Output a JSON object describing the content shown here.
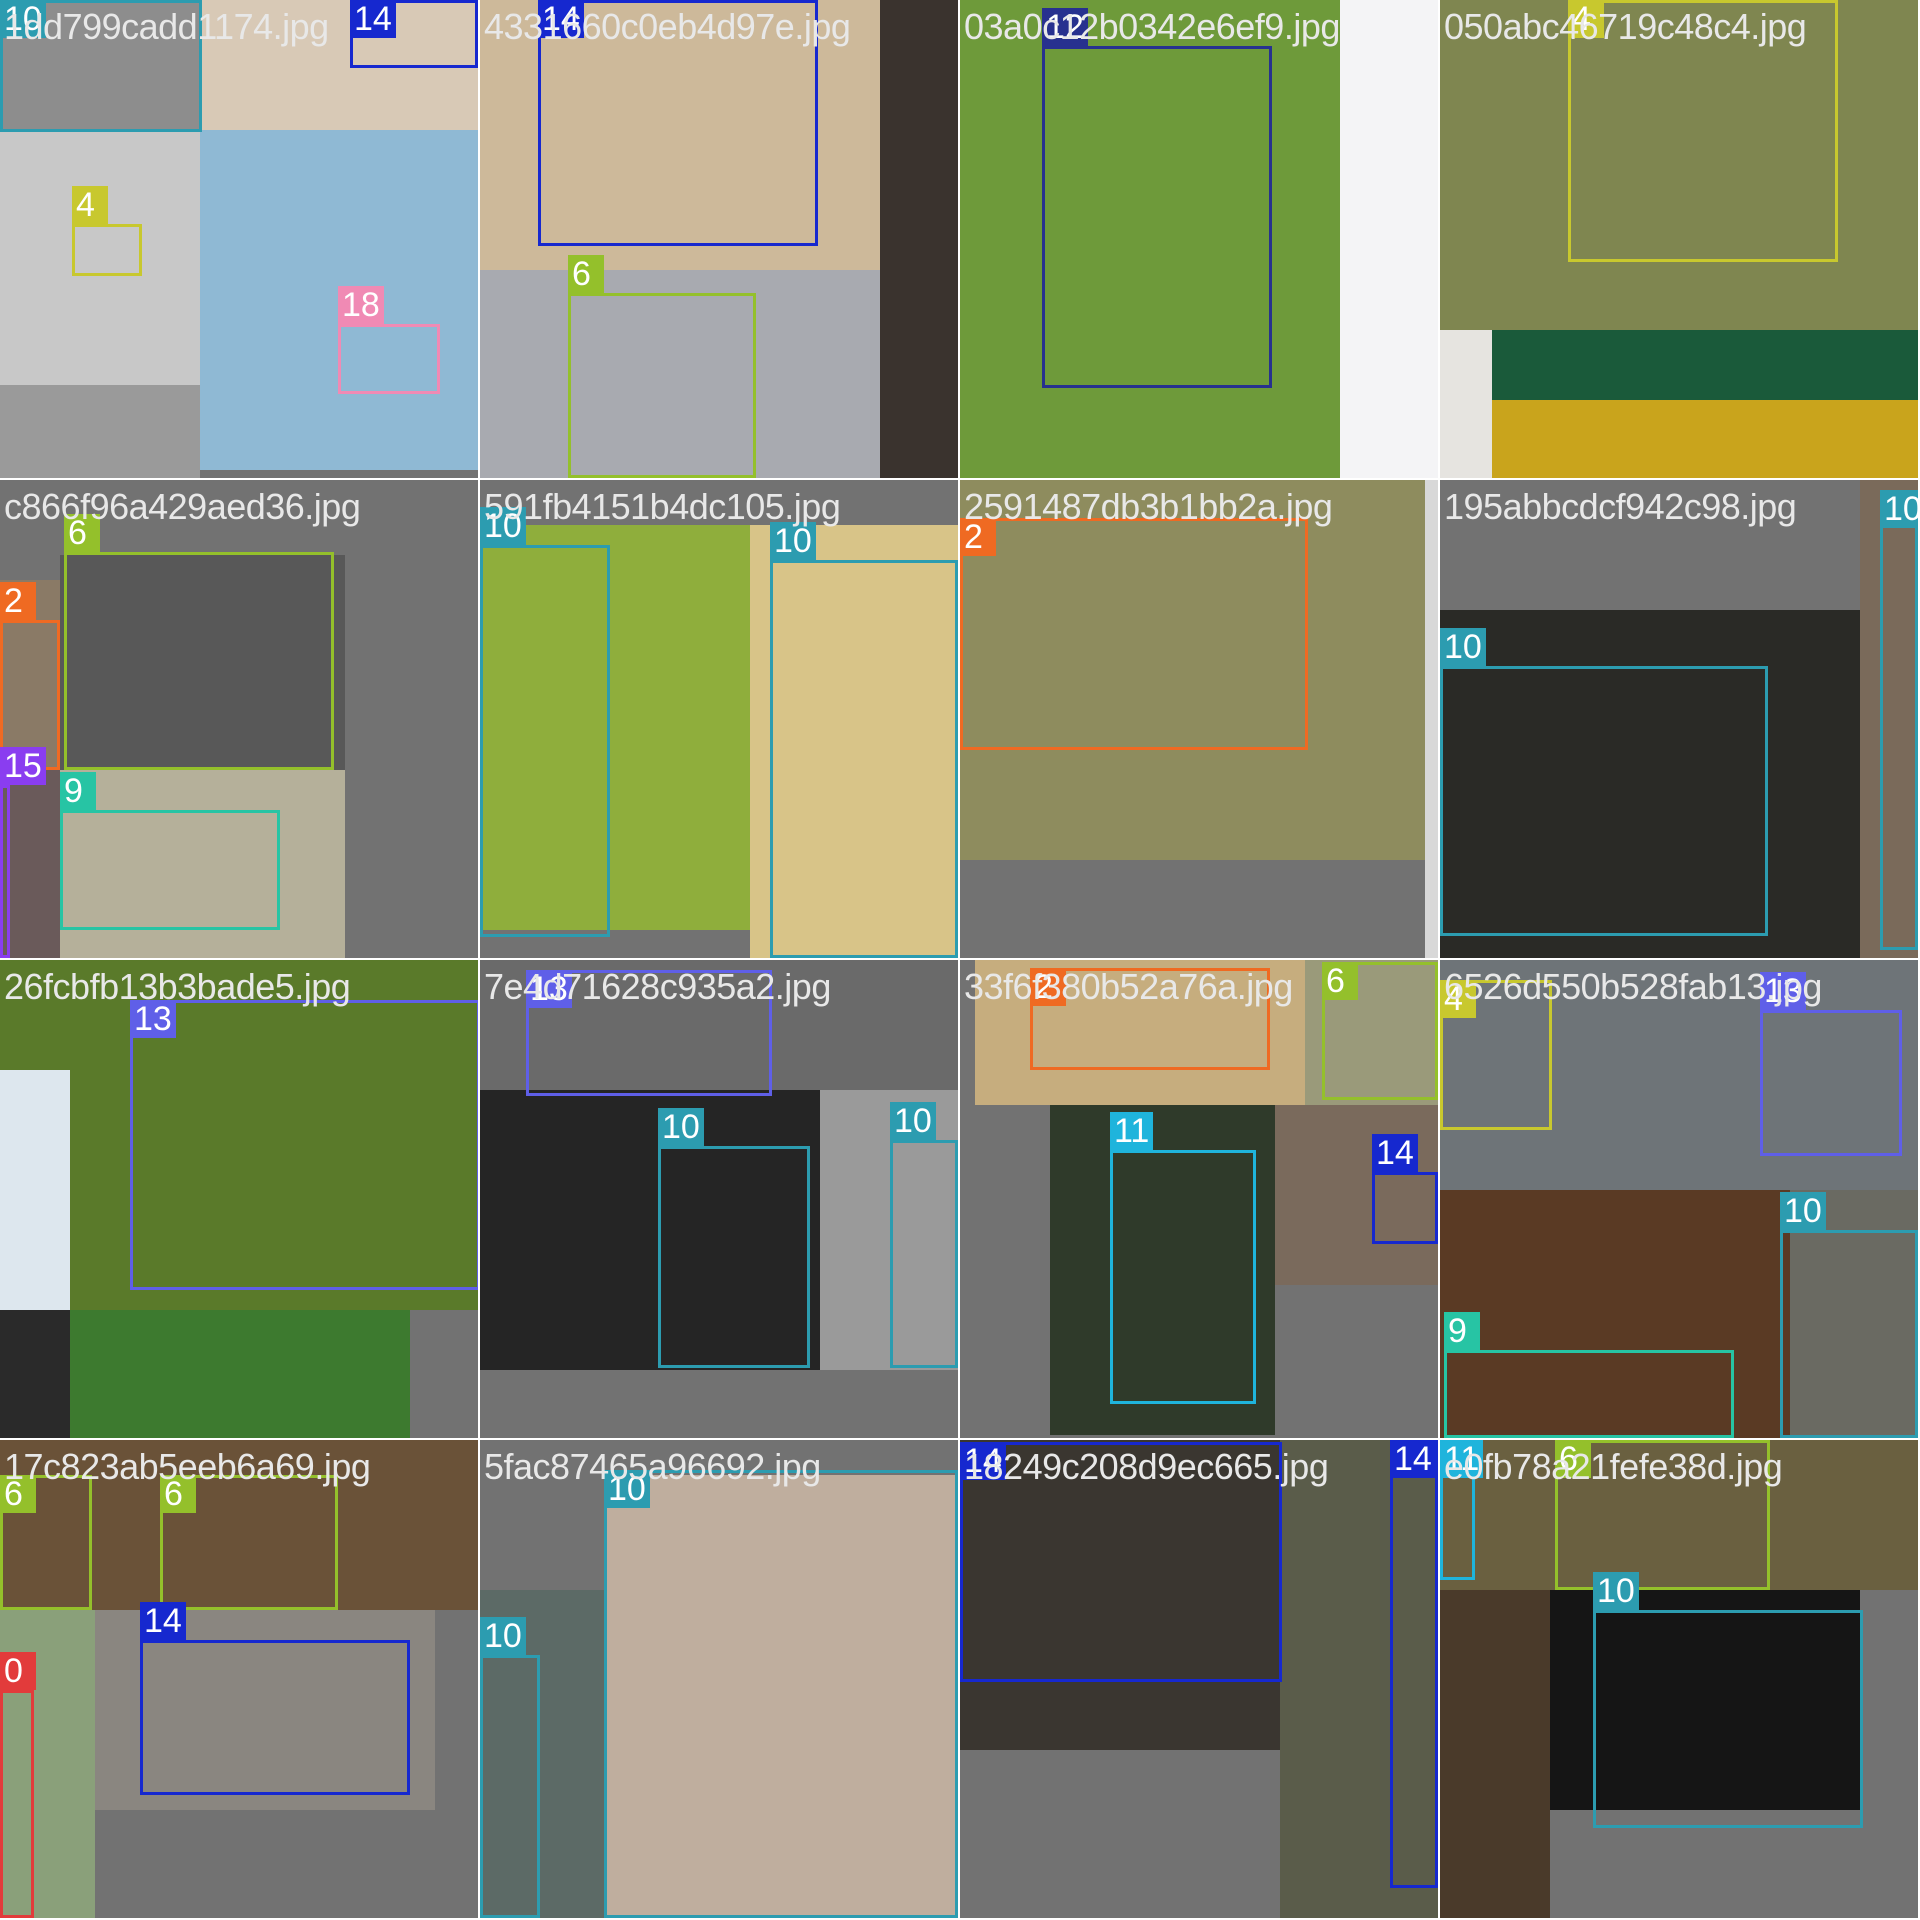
{
  "class_colors": {
    "0": "#e23b3b",
    "2": "#ef6a22",
    "4": "#c8c82e",
    "6": "#94c02b",
    "9": "#27c4a4",
    "10": "#2c9cb0",
    "11": "#1fb4dc",
    "12": "#27318f",
    "13": "#5f5fe8",
    "14": "#1628cf",
    "15": "#8a3df0",
    "18": "#f08ab4"
  },
  "tiles": [
    {
      "filename": "1dd799cadd1174.jpg",
      "boxes": [
        {
          "cls": "10"
        },
        {
          "cls": "14"
        },
        {
          "cls": "4"
        },
        {
          "cls": "18"
        }
      ]
    },
    {
      "filename": "4331660c0eb4d97e.jpg",
      "boxes": [
        {
          "cls": "14"
        },
        {
          "cls": "6"
        }
      ]
    },
    {
      "filename": "03a0c12b0342e6ef9.jpg",
      "boxes": [
        {
          "cls": "12"
        }
      ]
    },
    {
      "filename": "050abc46719c48c4.jpg",
      "boxes": [
        {
          "cls": "4"
        }
      ]
    },
    {
      "filename": "c866f96a429aed36.jpg",
      "boxes": [
        {
          "cls": "6"
        },
        {
          "cls": "2"
        },
        {
          "cls": "15"
        },
        {
          "cls": "9"
        }
      ]
    },
    {
      "filename": "591fb4151b4dc105.jpg",
      "boxes": [
        {
          "cls": "10"
        },
        {
          "cls": "10"
        }
      ]
    },
    {
      "filename": "2591487db3b1bb2a.jpg",
      "boxes": [
        {
          "cls": "2"
        }
      ]
    },
    {
      "filename": "195abbcdcf942c98.jpg",
      "boxes": [
        {
          "cls": "10"
        },
        {
          "cls": "10"
        }
      ]
    },
    {
      "filename": "26fcbfb13b3bade5.jpg",
      "boxes": [
        {
          "cls": "13"
        }
      ]
    },
    {
      "filename": "7e4d71628c935a2.jpg",
      "boxes": [
        {
          "cls": "13"
        },
        {
          "cls": "10"
        },
        {
          "cls": "10"
        }
      ]
    },
    {
      "filename": "33f6f380b52a76a.jpg",
      "boxes": [
        {
          "cls": "2"
        },
        {
          "cls": "6"
        },
        {
          "cls": "11"
        },
        {
          "cls": "14"
        }
      ]
    },
    {
      "filename": "6526d550b528fab13.jpg",
      "boxes": [
        {
          "cls": "4"
        },
        {
          "cls": "13"
        },
        {
          "cls": "10"
        },
        {
          "cls": "9"
        }
      ]
    },
    {
      "filename": "17c823ab5eeb6a69.jpg",
      "boxes": [
        {
          "cls": "6"
        },
        {
          "cls": "6"
        },
        {
          "cls": "14"
        },
        {
          "cls": "0"
        }
      ]
    },
    {
      "filename": "5fac87465a96692.jpg",
      "boxes": [
        {
          "cls": "10"
        },
        {
          "cls": "10"
        }
      ]
    },
    {
      "filename": "18249c208d9ec665.jpg",
      "boxes": [
        {
          "cls": "14"
        },
        {
          "cls": "14"
        }
      ]
    },
    {
      "filename": "e0fb78a21fefe38d.jpg",
      "boxes": [
        {
          "cls": "11"
        },
        {
          "cls": "6"
        },
        {
          "cls": "10"
        }
      ]
    }
  ]
}
